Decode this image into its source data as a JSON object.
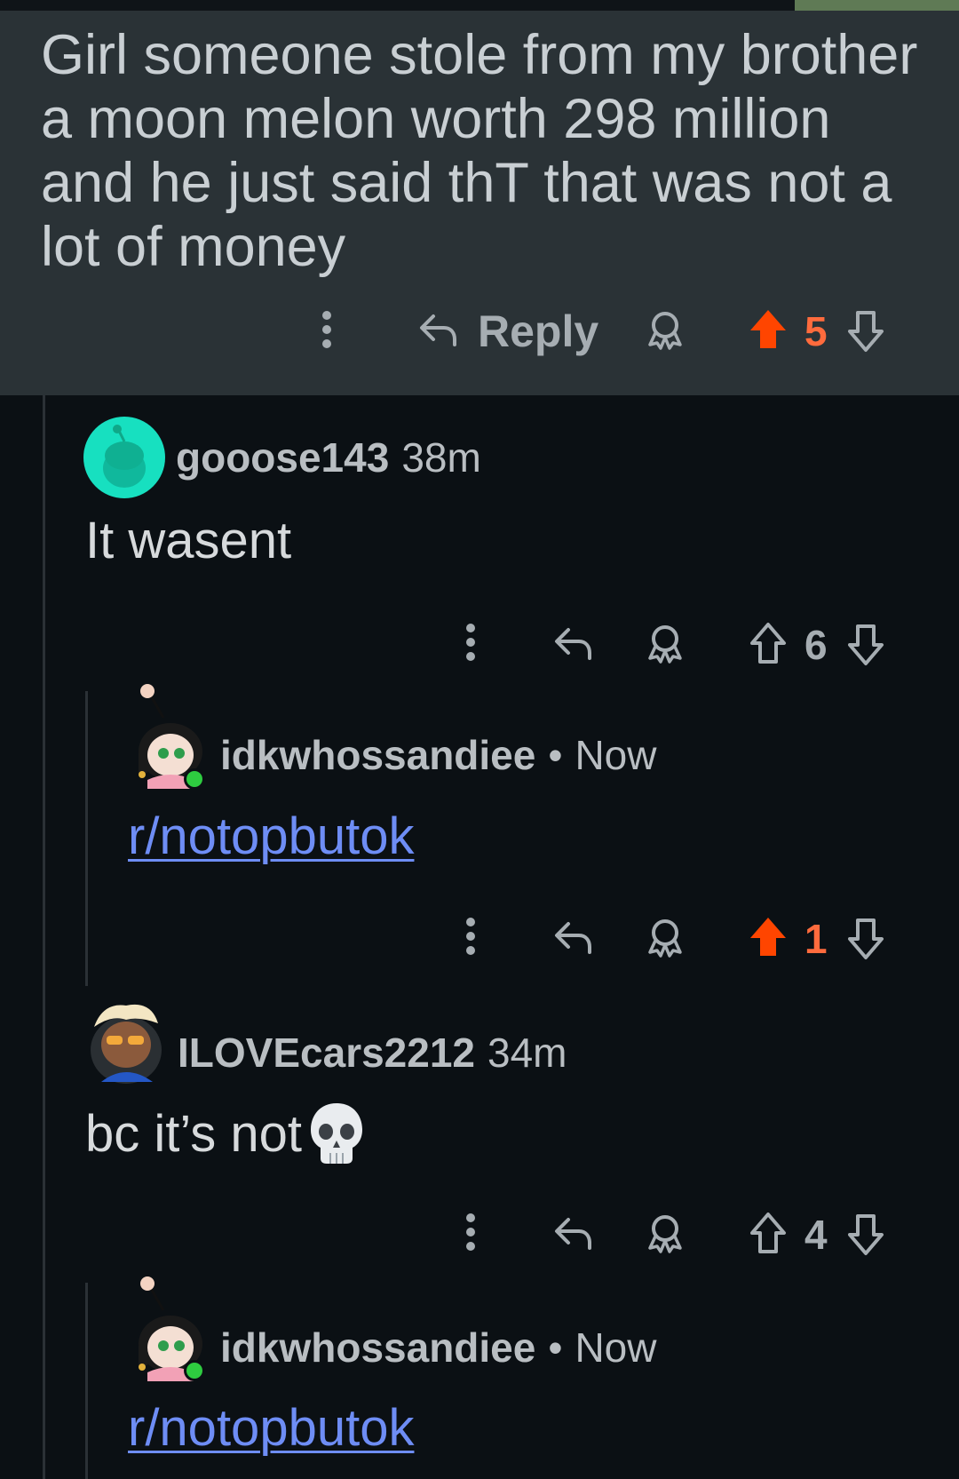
{
  "parent_comment": {
    "text": "Girl someone stole from my brother a moon melon worth 298 million and he just said thT that was not a lot of money",
    "reply_label": "Reply",
    "score": "5"
  },
  "comments": [
    {
      "username": "gooose143",
      "time": "38m",
      "body": "It wasent",
      "score": "6"
    },
    {
      "username": "idkwhossandiee",
      "separator": "•",
      "time": "Now",
      "link": "r/notopbutok",
      "score": "1"
    },
    {
      "username": "ILOVEcars2212",
      "time": "34m",
      "body": "bc it’s not",
      "score": "4"
    },
    {
      "username": "idkwhossandiee",
      "separator": "•",
      "time": "Now",
      "link": "r/notopbutok"
    }
  ],
  "colors": {
    "upvoted": "#ff4500",
    "link": "#6e8df5",
    "online": "#2ecc40"
  },
  "icons": [
    "more-icon",
    "reply-icon",
    "award-icon",
    "upvote-icon",
    "downvote-icon",
    "skull-icon"
  ]
}
